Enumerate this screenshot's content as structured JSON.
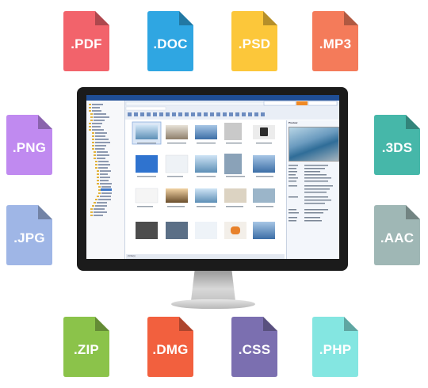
{
  "file_types": [
    {
      "label": ".PDF",
      "color": "#f2636b",
      "icon": "pdf-file-icon"
    },
    {
      "label": ".DOC",
      "color": "#2fa6e2",
      "icon": "doc-file-icon"
    },
    {
      "label": ".PSD",
      "color": "#fcc73a",
      "icon": "psd-file-icon"
    },
    {
      "label": ".MP3",
      "color": "#f47b5a",
      "icon": "mp3-file-icon"
    },
    {
      "label": ".PNG",
      "color": "#c08af0",
      "icon": "png-file-icon"
    },
    {
      "label": ".3DS",
      "color": "#46b7a9",
      "icon": "3ds-file-icon"
    },
    {
      "label": ".JPG",
      "color": "#9fb6e6",
      "icon": "jpg-file-icon"
    },
    {
      "label": ".AAC",
      "color": "#9fb7b5",
      "icon": "aac-file-icon"
    },
    {
      "label": ".ZIP",
      "color": "#8bc34a",
      "icon": "zip-file-icon"
    },
    {
      "label": ".DMG",
      "color": "#f2603e",
      "icon": "dmg-file-icon"
    },
    {
      "label": ".CSS",
      "color": "#7b6fb0",
      "icon": "css-file-icon"
    },
    {
      "label": ".PHP",
      "color": "#84e6e1",
      "icon": "php-file-icon"
    }
  ],
  "screen": {
    "statusbar": "21 file(s)",
    "preview_title": "Preview"
  }
}
